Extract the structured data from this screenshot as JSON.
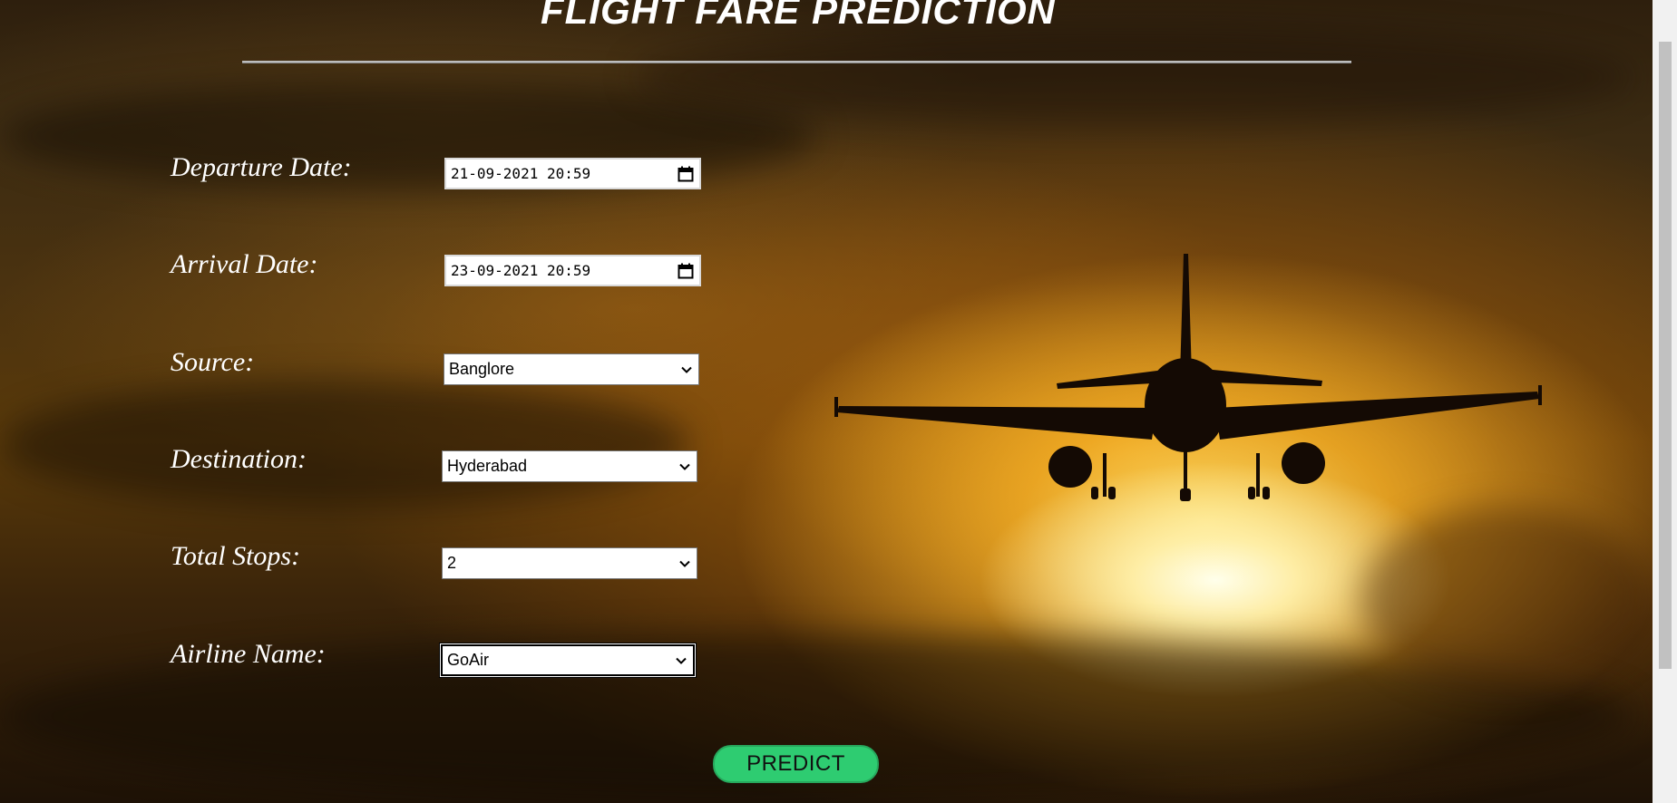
{
  "page": {
    "title": "FLIGHT FARE PREDICTION"
  },
  "form": {
    "departure": {
      "label": "Departure Date:",
      "value": "21-09-2021 20:59"
    },
    "arrival": {
      "label": "Arrival Date:",
      "value": "23-09-2021 20:59"
    },
    "source": {
      "label": "Source:",
      "value": "Banglore"
    },
    "destination": {
      "label": "Destination:",
      "value": "Hyderabad"
    },
    "stops": {
      "label": "Total Stops:",
      "value": "2"
    },
    "airline": {
      "label": "Airline Name:",
      "value": "GoAir"
    },
    "predict_label": "PREDICT"
  },
  "colors": {
    "accent_button": "#2ecc71",
    "title_text": "#ffffff"
  },
  "icons": {
    "date_picker": "calendar-icon",
    "select_arrow": "chevron-down-icon"
  }
}
